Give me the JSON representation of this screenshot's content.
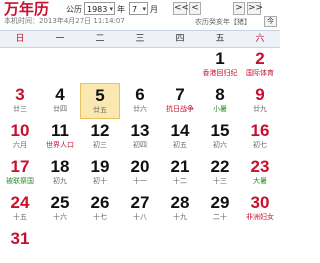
{
  "app": {
    "title": "万年历",
    "local_time": "本机时间：2013年4月27日 11:14:07"
  },
  "controls": {
    "calendar_label": "公历",
    "year_value": "1983",
    "year_suffix": "年",
    "month_value": "7",
    "month_suffix": "月",
    "prev_year": "<<",
    "prev_month": "<",
    "next_month": ">",
    "next_year": ">>",
    "lunar_info": "农历癸亥年【猪】",
    "today_button": "今"
  },
  "weekdays": [
    "日",
    "一",
    "二",
    "三",
    "四",
    "五",
    "六"
  ],
  "weeks": [
    [
      {
        "day": "",
        "sub": "",
        "type": ""
      },
      {
        "day": "",
        "sub": "",
        "type": ""
      },
      {
        "day": "",
        "sub": "",
        "type": ""
      },
      {
        "day": "",
        "sub": "",
        "type": ""
      },
      {
        "day": "",
        "sub": "",
        "type": ""
      },
      {
        "day": "1",
        "sub": "香港回归纪",
        "type": "holiday"
      },
      {
        "day": "2",
        "sub": "国际体育",
        "type": "holiday"
      }
    ],
    [
      {
        "day": "3",
        "sub": "廿三",
        "type": ""
      },
      {
        "day": "4",
        "sub": "廿四",
        "type": ""
      },
      {
        "day": "5",
        "sub": "廿五",
        "type": "",
        "today": true
      },
      {
        "day": "6",
        "sub": "廿六",
        "type": ""
      },
      {
        "day": "7",
        "sub": "抗日战争",
        "type": "holiday"
      },
      {
        "day": "8",
        "sub": "小暑",
        "type": "solar"
      },
      {
        "day": "9",
        "sub": "廿九",
        "type": ""
      }
    ],
    [
      {
        "day": "10",
        "sub": "六月",
        "type": ""
      },
      {
        "day": "11",
        "sub": "世界人口",
        "type": "holiday"
      },
      {
        "day": "12",
        "sub": "初三",
        "type": ""
      },
      {
        "day": "13",
        "sub": "初四",
        "type": ""
      },
      {
        "day": "14",
        "sub": "初五",
        "type": ""
      },
      {
        "day": "15",
        "sub": "初六",
        "type": ""
      },
      {
        "day": "16",
        "sub": "初七",
        "type": ""
      }
    ],
    [
      {
        "day": "17",
        "sub": "被联祭国",
        "type": "solar"
      },
      {
        "day": "18",
        "sub": "初九",
        "type": ""
      },
      {
        "day": "19",
        "sub": "初十",
        "type": ""
      },
      {
        "day": "20",
        "sub": "十一",
        "type": ""
      },
      {
        "day": "21",
        "sub": "十二",
        "type": ""
      },
      {
        "day": "22",
        "sub": "十三",
        "type": ""
      },
      {
        "day": "23",
        "sub": "大暑",
        "type": "solar"
      }
    ],
    [
      {
        "day": "24",
        "sub": "十五",
        "type": ""
      },
      {
        "day": "25",
        "sub": "十六",
        "type": ""
      },
      {
        "day": "26",
        "sub": "十七",
        "type": ""
      },
      {
        "day": "27",
        "sub": "十八",
        "type": ""
      },
      {
        "day": "28",
        "sub": "十九",
        "type": ""
      },
      {
        "day": "29",
        "sub": "二十",
        "type": ""
      },
      {
        "day": "30",
        "sub": "非洲妇女",
        "type": "holiday"
      }
    ],
    [
      {
        "day": "31",
        "sub": "",
        "type": ""
      },
      {
        "day": "",
        "sub": "",
        "type": ""
      },
      {
        "day": "",
        "sub": "",
        "type": ""
      },
      {
        "day": "",
        "sub": "",
        "type": ""
      },
      {
        "day": "",
        "sub": "",
        "type": ""
      },
      {
        "day": "",
        "sub": "",
        "type": ""
      },
      {
        "day": "",
        "sub": "",
        "type": ""
      }
    ]
  ]
}
